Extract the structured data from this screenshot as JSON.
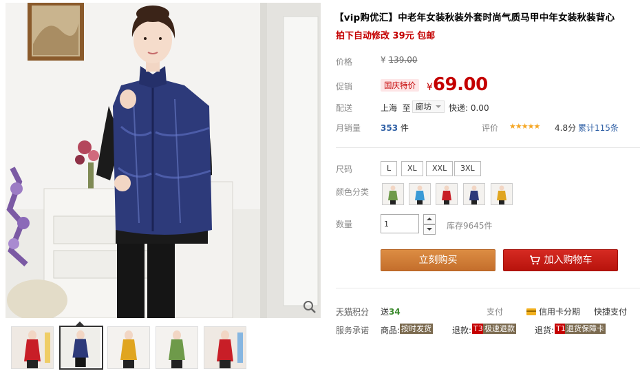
{
  "product": {
    "title": "【vip购优汇】中老年女装秋装外套时尚气质马甲中年女装秋装背心",
    "promo_note": "拍下自动修改 39元 包邮"
  },
  "price": {
    "label": "价格",
    "currency": "¥",
    "original": "139.00"
  },
  "promotion": {
    "label": "促销",
    "tag": "国庆特价",
    "currency": "¥",
    "price": "69.00"
  },
  "shipping": {
    "label": "配送",
    "from": "上海",
    "to_word": "至",
    "destination": "廊坊",
    "fee": "快递: 0.00"
  },
  "sales": {
    "label": "月销量",
    "count": "353",
    "unit": "件"
  },
  "rating": {
    "label": "评价",
    "stars": "★★★★★",
    "score": "4.8分",
    "reviews": "累计115条"
  },
  "size": {
    "label": "尺码",
    "options": [
      "L",
      "XL",
      "XXL",
      "3XL"
    ]
  },
  "color": {
    "label": "颜色分类",
    "options": [
      "green-vest",
      "blue-vest",
      "red-vest",
      "navy-vest",
      "yellow-vest"
    ]
  },
  "quantity": {
    "label": "数量",
    "value": "1",
    "stock": "库存9645件"
  },
  "actions": {
    "buy": "立刻购买",
    "cart": "加入购物车"
  },
  "points": {
    "label": "天猫积分",
    "prefix": "送",
    "value": "34"
  },
  "payment": {
    "label": "支付",
    "credit": "信用卡分期",
    "fast": "快捷支付"
  },
  "services": {
    "label": "服务承诺",
    "goods_label": "商品:",
    "goods_tag": "按时发货",
    "refund_label": "退款:",
    "refund_t": "T3",
    "refund_tag": "极速退款",
    "return_label": "退货:",
    "return_t": "T1",
    "return_tag": "退货保障卡"
  },
  "gallery": {
    "thumbnails": [
      "red-vest",
      "navy-vest",
      "yellow-vest",
      "green-vest",
      "red-vest"
    ],
    "active_index": 1
  },
  "colors": {
    "accent_red": "#c40000",
    "buy_orange": "#d07a36",
    "cart_red": "#c8170f",
    "vest_navy": "#2d3a7a"
  }
}
